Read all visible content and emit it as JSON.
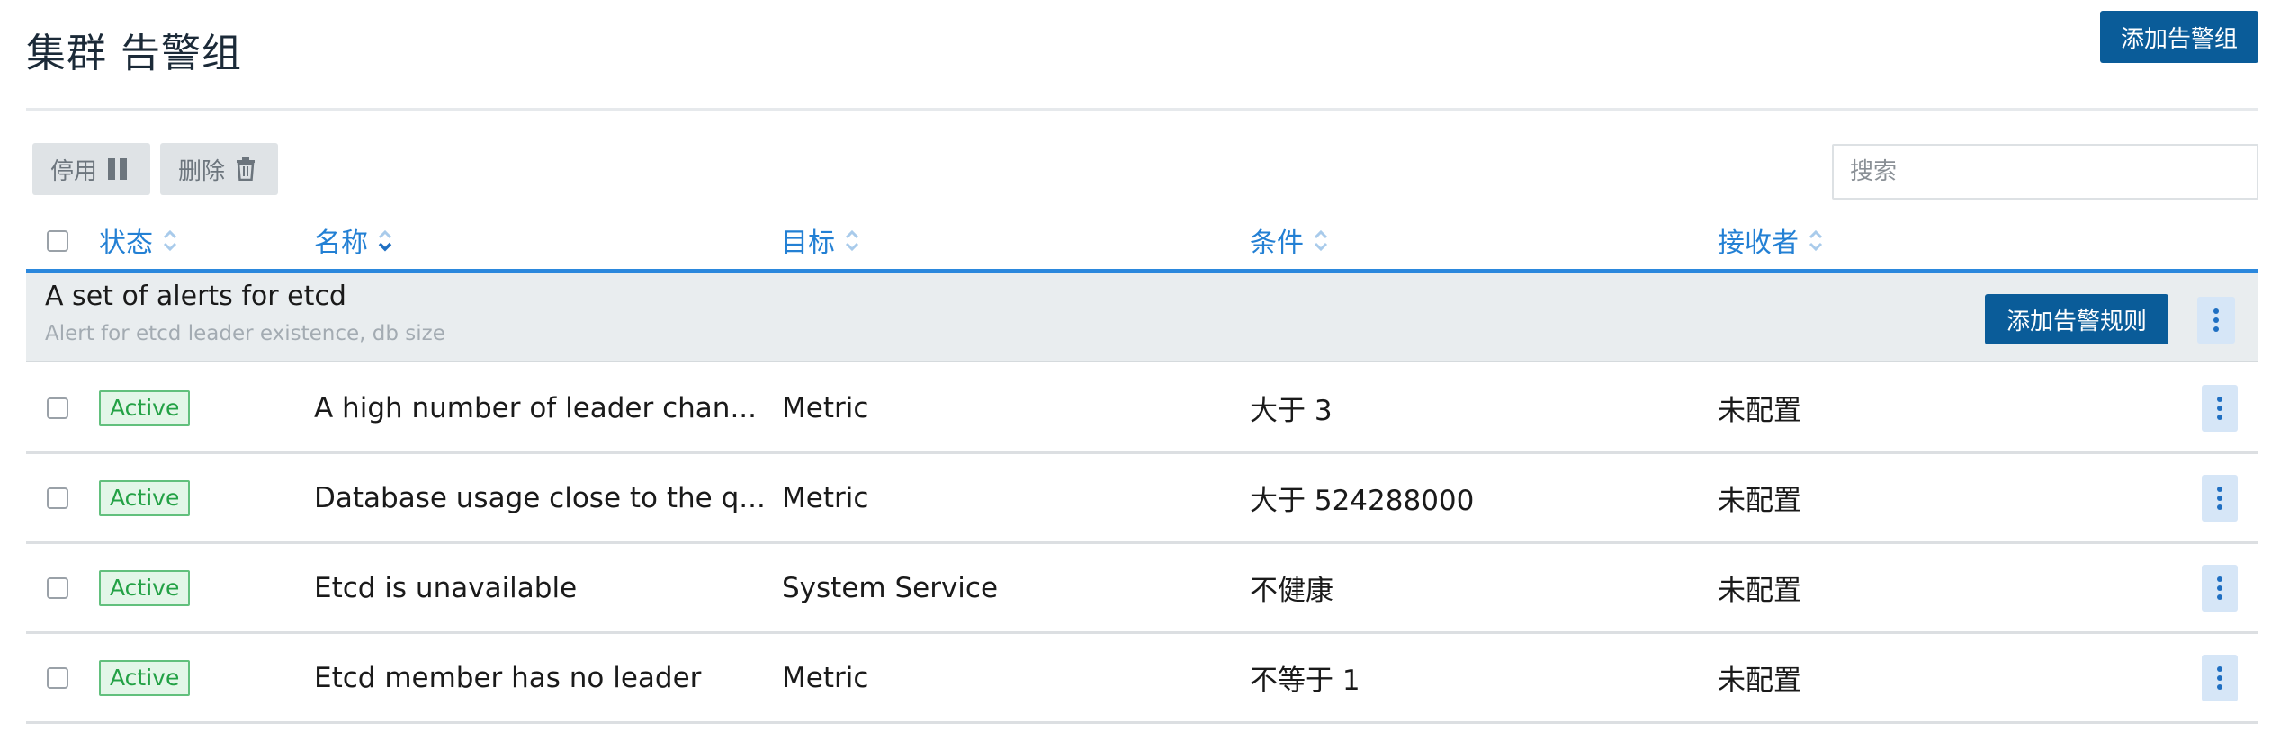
{
  "page": {
    "title": "集群 告警组",
    "add_group_label": "添加告警组"
  },
  "toolbar": {
    "pause_label": "停用",
    "delete_label": "删除",
    "search_placeholder": "搜索"
  },
  "table": {
    "columns": {
      "state": "状态",
      "name": "名称",
      "target": "目标",
      "condition": "条件",
      "recipients": "接收者"
    },
    "sort": {
      "column": "name",
      "direction": "desc"
    },
    "group": {
      "title": "A set of alerts for etcd",
      "description": "Alert for etcd leader existence, db size",
      "add_rule_label": "添加告警规则"
    },
    "rows": [
      {
        "state": "Active",
        "name": "A high number of leader chan...",
        "target": "Metric",
        "condition": "大于 3",
        "recipients": "未配置"
      },
      {
        "state": "Active",
        "name": "Database usage close to the q...",
        "target": "Metric",
        "condition": "大于 524288000",
        "recipients": "未配置"
      },
      {
        "state": "Active",
        "name": "Etcd is unavailable",
        "target": "System Service",
        "condition": "不健康",
        "recipients": "未配置"
      },
      {
        "state": "Active",
        "name": "Etcd member has no leader",
        "target": "Metric",
        "condition": "不等于 1",
        "recipients": "未配置"
      }
    ]
  },
  "colors": {
    "primary": "#0a5c99",
    "link": "#2380d4",
    "active_badge_text": "#23a145",
    "active_badge_bg": "#e3f6e8",
    "group_row_bg": "#e9edef"
  },
  "icons": {
    "pause": "pause-icon",
    "delete": "trash-icon",
    "sort": "sort-icon",
    "kebab": "more-vertical-icon"
  }
}
